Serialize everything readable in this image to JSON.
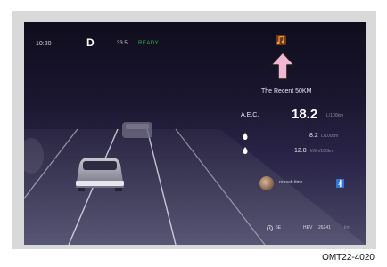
{
  "status_bar": {
    "time": "10:20",
    "gear": "D",
    "range": "33.5",
    "drive_mode": "READY"
  },
  "trip_panel": {
    "title": "The Recent 50KM",
    "aec_label": "A.E.C.",
    "aec_value": "18.2",
    "aec_unit": "L/100km",
    "fuel_value": "8.2",
    "fuel_unit": "L/100km",
    "electric_value": "12.8",
    "electric_unit": "kWh/100km"
  },
  "media": {
    "track": "refresh time"
  },
  "bottom_bar": {
    "time": "5E",
    "mode": "HEV",
    "odometer": "26241",
    "odometer_unit": "km"
  },
  "caption": "OMT22-4020",
  "colors": {
    "ready_green": "#3bb04a",
    "callout_pink": "#f2b6d4",
    "bluetooth_blue": "#2f74d8"
  },
  "icons": [
    "music-note-icon",
    "up-arrow-callout-icon",
    "fuel-drop-icon",
    "electric-drop-icon",
    "bluetooth-icon",
    "clock-icon"
  ]
}
